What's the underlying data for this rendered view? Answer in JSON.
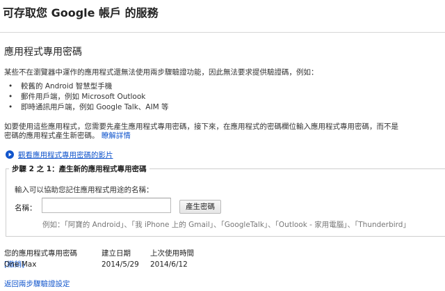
{
  "header": {
    "title": "可存取您 Google 帳戶 的服務"
  },
  "section": {
    "title": "應用程式專用密碼"
  },
  "intro": {
    "text": "某些不在瀏覽器中運作的應用程式還無法使用兩步驟驗證功能，因此無法要求提供驗證碼，例如："
  },
  "clients": [
    {
      "bullet": "•",
      "text": "較舊的 Android 智慧型手機"
    },
    {
      "bullet": "•",
      "text": "郵件用戶端，例如 Microsoft Outlook"
    },
    {
      "bullet": "•",
      "text": "即時通訊用戶端，例如 Google Talk、AIM 等"
    }
  ],
  "instructions": {
    "line1": "如要使用這些應用程式，您需要先產生應用程式專用密碼，接下來，在應用程式的密碼欄位輸入應用程式專用密碼，而不是",
    "line2": "密碼的應用程式產生新密碼。",
    "learn_more": "瞭解詳情"
  },
  "video": {
    "link": "觀看應用程式專用密碼的影片",
    "icon": "play-circle-icon",
    "icon_color": "#1155cc"
  },
  "step": {
    "legend": "步驟 2 之 1：產生新的應用程式專用密碼",
    "hint": "輸入可以協助您記住應用程式用途的名稱：",
    "name_label": "名稱：",
    "name_value": "",
    "name_placeholder": "",
    "button": "產生密碼",
    "example": "例如：「阿寶的 Android」、「我 iPhone 上的 Gmail」、「GoogleTalk」、「Outlook - 家用電腦」、「Thunderbird」"
  },
  "passwords": {
    "headers": [
      "您的應用程式專用密碼",
      "建立日期",
      "上次使用時間",
      ""
    ],
    "rows": [
      {
        "name": "One Max",
        "created": "2014/5/29",
        "last_used": "2014/6/12",
        "action": "[撤銷]"
      }
    ]
  },
  "footer": {
    "back_link": "返回兩步驟驗證設定"
  },
  "colors": {
    "link": "#1155cc",
    "divider": "#d6d6d6",
    "muted": "#777777"
  }
}
